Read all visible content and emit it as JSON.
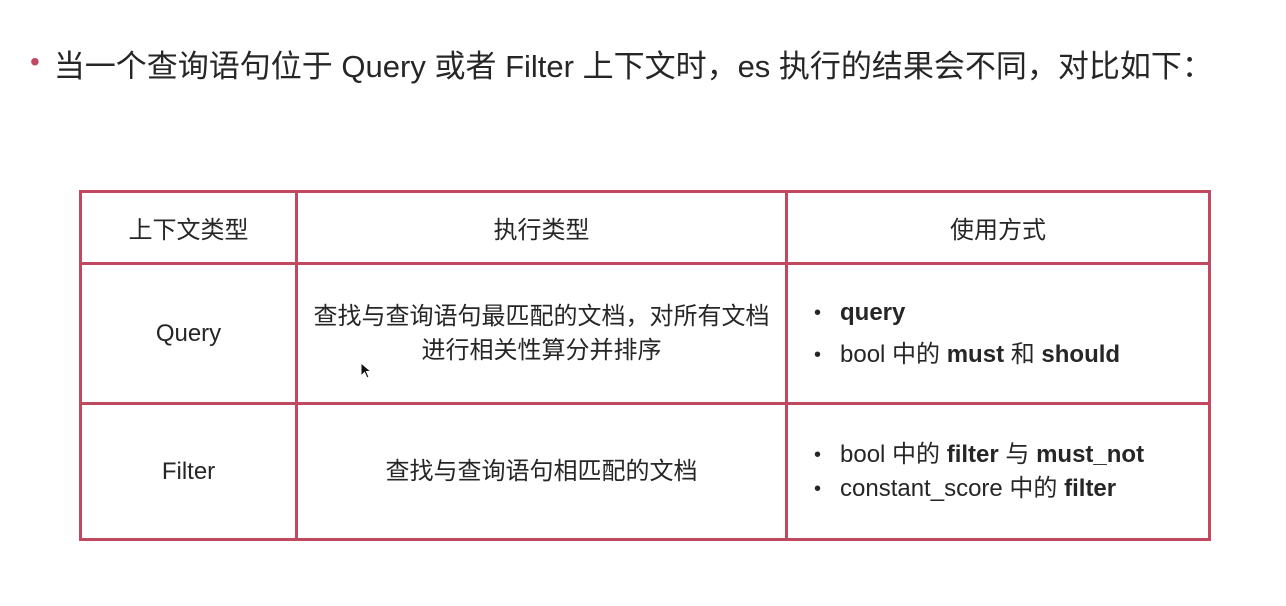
{
  "heading": {
    "bullet": "•",
    "text": "当一个查询语句位于 Query 或者 Filter 上下文时，es 执行的结果会不同，对比如下："
  },
  "table": {
    "headers": [
      "上下文类型",
      "执行类型",
      "使用方式"
    ],
    "rows": [
      {
        "context": "Query",
        "exec_type": "查找与查询语句最匹配的文档，对所有文档进行相关性算分并排序",
        "usage": [
          {
            "parts": [
              "query"
            ]
          },
          {
            "parts": [
              "bool 中的 ",
              "must",
              " 和 ",
              "should"
            ]
          }
        ]
      },
      {
        "context": "Filter",
        "exec_type": "查找与查询语句相匹配的文档",
        "usage": [
          {
            "parts": [
              "bool 中的 ",
              "filter",
              " 与 ",
              "must_not"
            ]
          },
          {
            "parts": [
              "constant_score 中的 ",
              "filter"
            ]
          }
        ]
      }
    ]
  },
  "colors": {
    "accent": "#c0485f",
    "text": "#262626"
  }
}
